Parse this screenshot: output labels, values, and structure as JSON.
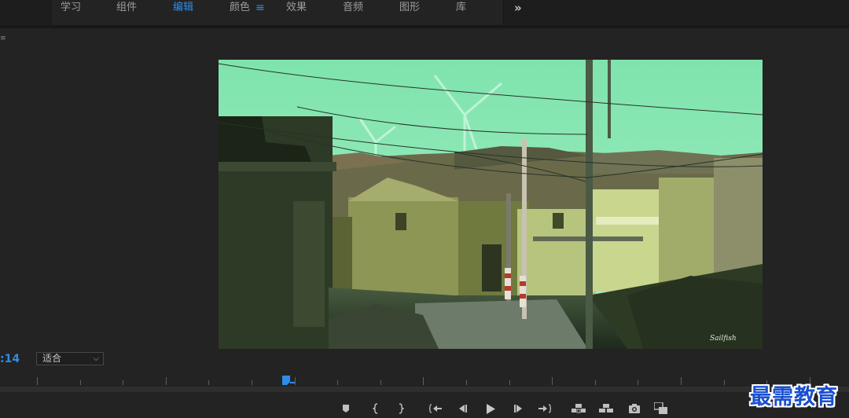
{
  "workspaces": {
    "tabs": [
      {
        "label": "学习",
        "active": false
      },
      {
        "label": "组件",
        "active": false
      },
      {
        "label": "编辑",
        "active": true
      },
      {
        "label": "颜色",
        "active": false
      },
      {
        "label": "效果",
        "active": false
      },
      {
        "label": "音频",
        "active": false
      },
      {
        "label": "图形",
        "active": false
      },
      {
        "label": "库",
        "active": false
      }
    ],
    "menu_glyph": "≡",
    "more_glyph": "»"
  },
  "monitor": {
    "panel_menu_glyph": "≡",
    "timecode": ":14",
    "fit": {
      "selected": "适合"
    },
    "video": {
      "signature": "Sailfish"
    }
  },
  "controls": {
    "icons": [
      "add-marker-icon",
      "mark-in-icon",
      "mark-out-icon",
      "go-to-in-icon",
      "step-back-icon",
      "play-icon",
      "step-forward-icon",
      "go-to-out-icon",
      "lift-icon",
      "extract-icon",
      "export-frame-icon",
      "comparison-view-icon"
    ]
  },
  "colors": {
    "accent": "#2d8ceb",
    "panel": "#232323",
    "header": "#1d1d1d"
  },
  "watermark": "最需教育"
}
